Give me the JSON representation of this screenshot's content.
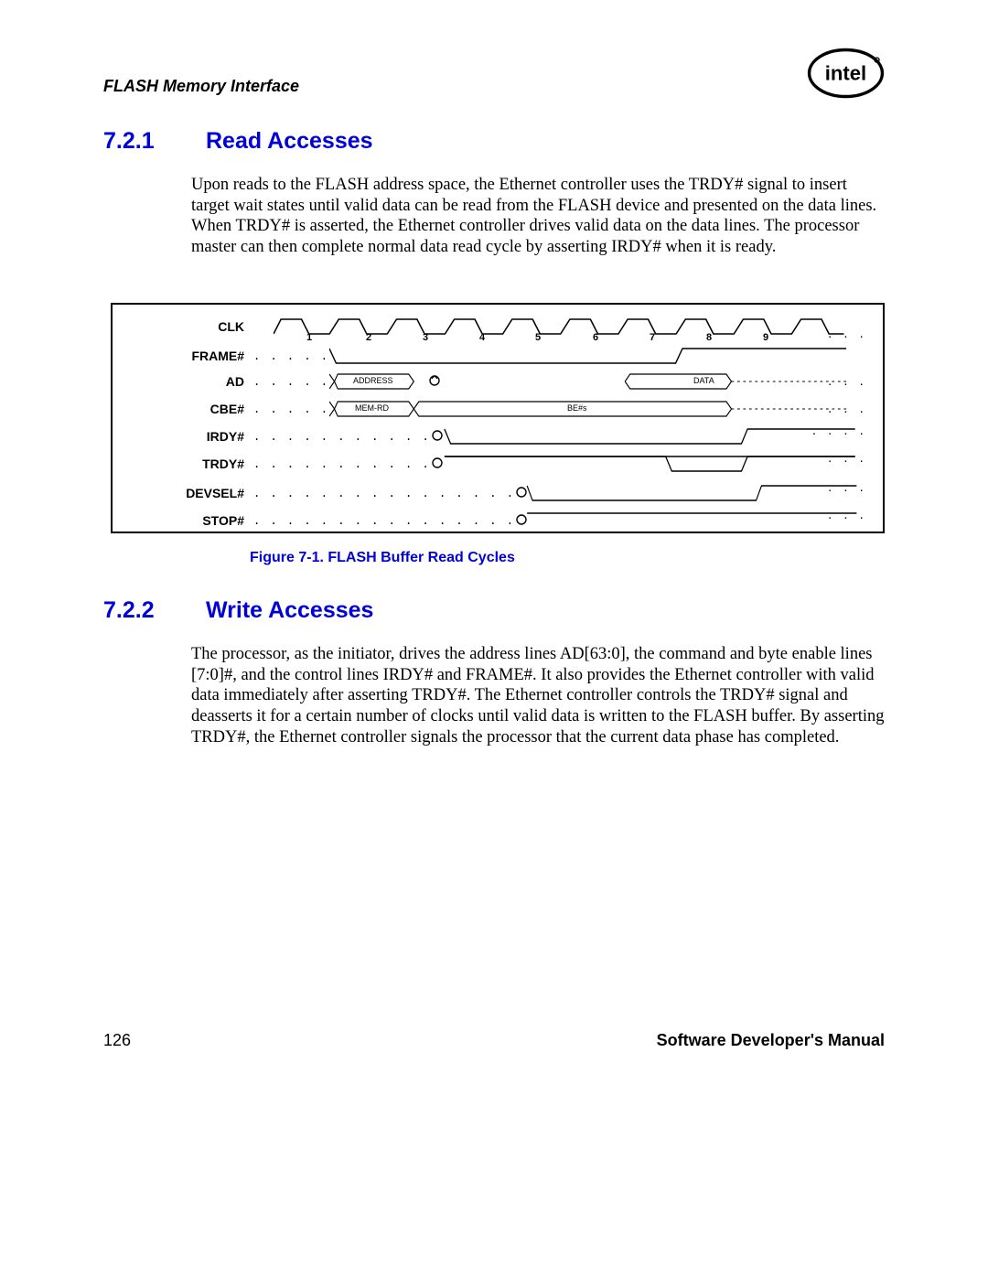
{
  "header": {
    "title": "FLASH Memory Interface",
    "logo_text": "intel"
  },
  "section1": {
    "num": "7.2.1",
    "title": "Read Accesses",
    "body": "Upon reads to the FLASH address space, the Ethernet controller uses the TRDY# signal to insert target wait states until valid data can be read from the FLASH device and presented on the data lines. When TRDY# is asserted, the Ethernet controller drives valid data on the data lines. The processor master can then complete normal data read cycle by asserting IRDY# when it is ready."
  },
  "figure": {
    "signals": [
      "CLK",
      "FRAME#",
      "AD",
      "CBE#",
      "IRDY#",
      "TRDY#",
      "DEVSEL#",
      "STOP#"
    ],
    "clk_cycles": [
      "1",
      "2",
      "3",
      "4",
      "5",
      "6",
      "7",
      "8",
      "9"
    ],
    "ad_labels": {
      "addr": "ADDRESS",
      "data": "DATA"
    },
    "cbe_labels": {
      "cmd": "MEM-RD",
      "be": "BE#s"
    },
    "caption": "Figure 7-1. FLASH Buffer Read Cycles"
  },
  "section2": {
    "num": "7.2.2",
    "title": "Write Accesses",
    "body": "The processor, as the initiator, drives the address lines AD[63:0], the command and byte enable lines [7:0]#, and the control lines IRDY# and FRAME#. It also provides the Ethernet controller with valid data immediately after asserting TRDY#. The Ethernet controller controls the TRDY# signal and deasserts it for a certain number of clocks until valid data is written to the FLASH buffer. By asserting TRDY#, the Ethernet controller signals the processor that the current data phase has completed."
  },
  "footer": {
    "page": "126",
    "title": "Software Developer's Manual"
  }
}
